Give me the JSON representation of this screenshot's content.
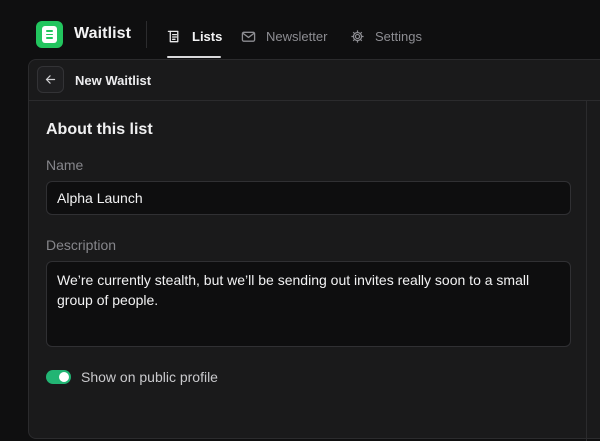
{
  "app": {
    "brand": "Waitlist",
    "logo_icon": "list-icon",
    "accent_color": "#22c55e"
  },
  "nav": {
    "items": [
      {
        "label": "Lists",
        "icon": "list-icon",
        "active": true
      },
      {
        "label": "Newsletter",
        "icon": "mail-icon",
        "active": false
      },
      {
        "label": "Settings",
        "icon": "gear-icon",
        "active": false
      }
    ]
  },
  "panel": {
    "title": "New Waitlist",
    "back_icon": "arrow-left-icon"
  },
  "form": {
    "section_title": "About this list",
    "name_label": "Name",
    "name_value": "Alpha Launch",
    "description_label": "Description",
    "description_value": "We’re currently stealth, but we’ll be sending out invites really soon to a small group of people.",
    "public_profile_label": "Show on public profile",
    "public_profile_on": true,
    "toggle_color": "#22b574"
  }
}
